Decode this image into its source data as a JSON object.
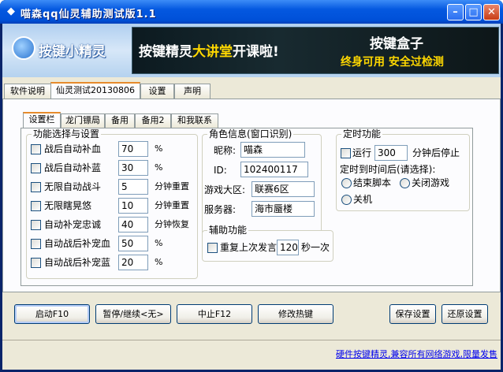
{
  "window": {
    "title": "喵森qq仙灵辅助测试版1.1",
    "icon": "app-icon",
    "min_glyph": "–",
    "max_glyph": "□",
    "close_glyph": "✕"
  },
  "banner": {
    "logo_text": "按键小精灵",
    "ad_part1": "按键精灵",
    "ad_part2": "大讲堂",
    "ad_part3": "开课啦!",
    "ad_box_title": "按键盒子",
    "ad_slogan": "终身可用  安全过检测"
  },
  "main_tabs": [
    "软件说明",
    "仙灵测试20130806",
    "设置",
    "声明"
  ],
  "sub_tabs": [
    "设置栏",
    "龙门镖局",
    "备用",
    "备用2",
    "和我联系"
  ],
  "functions": {
    "title": "功能选择与设置",
    "rows": [
      {
        "label": "战后自动补血",
        "value": "70",
        "unit": "%"
      },
      {
        "label": "战后自动补蓝",
        "value": "30",
        "unit": "%"
      },
      {
        "label": "无限自动战斗",
        "value": "5",
        "unit": "分钟重置"
      },
      {
        "label": "无限瞎晃悠",
        "value": "10",
        "unit": "分钟重置"
      },
      {
        "label": "自动补宠忠诚",
        "value": "40",
        "unit": "分钟恢复"
      },
      {
        "label": "自动战后补宠血",
        "value": "50",
        "unit": "%"
      },
      {
        "label": "自动战后补宠蓝",
        "value": "20",
        "unit": "%"
      }
    ]
  },
  "role": {
    "title": "角色信息(窗口识别)",
    "nickname_label": "昵称:",
    "nickname": "喵森",
    "id_label": "ID:",
    "id": "102400117",
    "region_label": "游戏大区:",
    "region": "联赛6区",
    "server_label": "服务器:",
    "server": "海市蜃楼"
  },
  "assist": {
    "title": "辅助功能",
    "label": "重复上次发言",
    "value": "120",
    "unit": "秒一次"
  },
  "timer": {
    "title": "定时功能",
    "run_label": "运行",
    "run_value": "300",
    "run_unit": "分钟后停止",
    "after_label": "定时到时间后(请选择):",
    "options": [
      "结束脚本",
      "关闭游戏",
      "关机"
    ]
  },
  "buttons": {
    "start": "启动F10",
    "pause": "暂停/继续<无>",
    "stop": "中止F12",
    "hotkey": "修改热键",
    "save": "保存设置",
    "restore": "还原设置"
  },
  "footer_link": "硬件按键精灵,兼容所有网络游戏,限量发售"
}
